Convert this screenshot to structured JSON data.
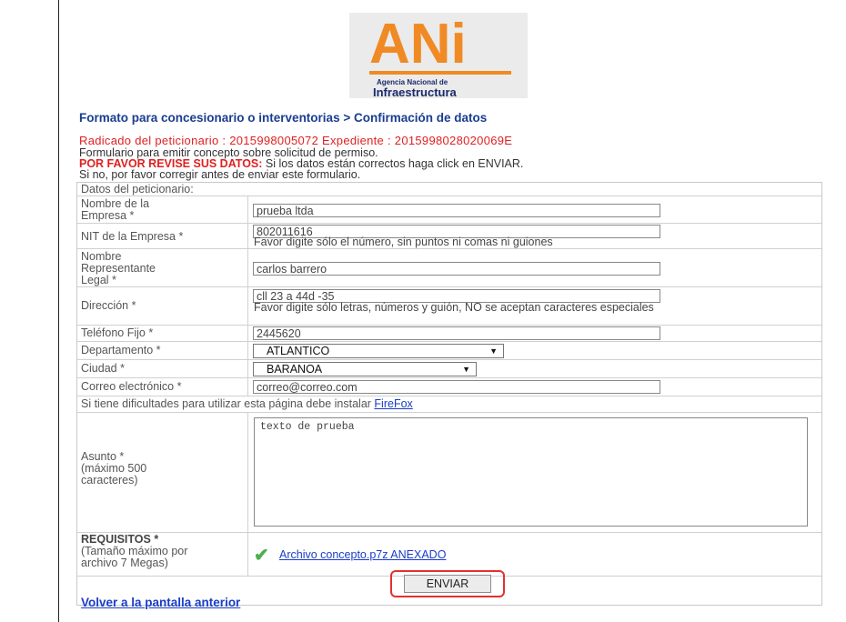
{
  "logo": {
    "text": "ANi",
    "sub1": "Agencia Nacional de",
    "sub2": "Infraestructura"
  },
  "breadcrumb": "Formato para concesionario o interventorias > Confirmación de datos",
  "radicado_line": "Radicado del peticionario : 2015998005072 Expediente : 2015998028020069E",
  "info": {
    "line1": "Formulario para emitir concepto sobre solicitud de permiso.",
    "line2_red": "POR FAVOR REVISE SUS DATOS:",
    "line2_rest": " Si los datos están correctos haga click en ENVIAR.",
    "line3": "Si no, por favor corregir antes de enviar este formulario."
  },
  "form": {
    "section_title": "Datos del peticionario:",
    "empresa": {
      "label": "Nombre de la Empresa *",
      "value": "prueba ltda"
    },
    "nit": {
      "label": "NIT de la Empresa *",
      "value": "802011616",
      "help": "Favor digite sólo el número, sin puntos ni comas ni guiones"
    },
    "representante": {
      "label": "Nombre Representante Legal *",
      "value": "carlos barrero"
    },
    "direccion": {
      "label": "Dirección *",
      "value": "cll 23 a 44d -35",
      "help": "Favor digite sólo letras, números y guión, NO se aceptan caracteres especiales"
    },
    "telefono": {
      "label": "Teléfono Fijo *",
      "value": "2445620"
    },
    "departamento": {
      "label": "Departamento *",
      "value": "ATLANTICO"
    },
    "ciudad": {
      "label": "Ciudad *",
      "value": "BARANOA"
    },
    "correo": {
      "label": "Correo electrónico *",
      "value": "correo@correo.com"
    },
    "firefox_note": "Si tiene dificultades para utilizar esta página debe instalar ",
    "firefox_link": "FireFox",
    "asunto": {
      "label": "Asunto *",
      "sublabel": "(máximo 500 caracteres)",
      "value": "texto de prueba"
    },
    "requisitos": {
      "label": "REQUISITOS *",
      "sublabel": "(Tamaño máximo por archivo 7 Megas)",
      "file_link": "Archivo concepto.p7z ANEXADO"
    },
    "submit_label": "ENVIAR",
    "back_link": "Volver a la pantalla anterior"
  },
  "icons": [
    "check-icon",
    "dropdown-arrow-icon"
  ],
  "colors": {
    "logo_orange": "#f08a24",
    "alert_red": "#e02020",
    "link_blue": "#1a3dc6",
    "highlight_red": "#e53030"
  }
}
